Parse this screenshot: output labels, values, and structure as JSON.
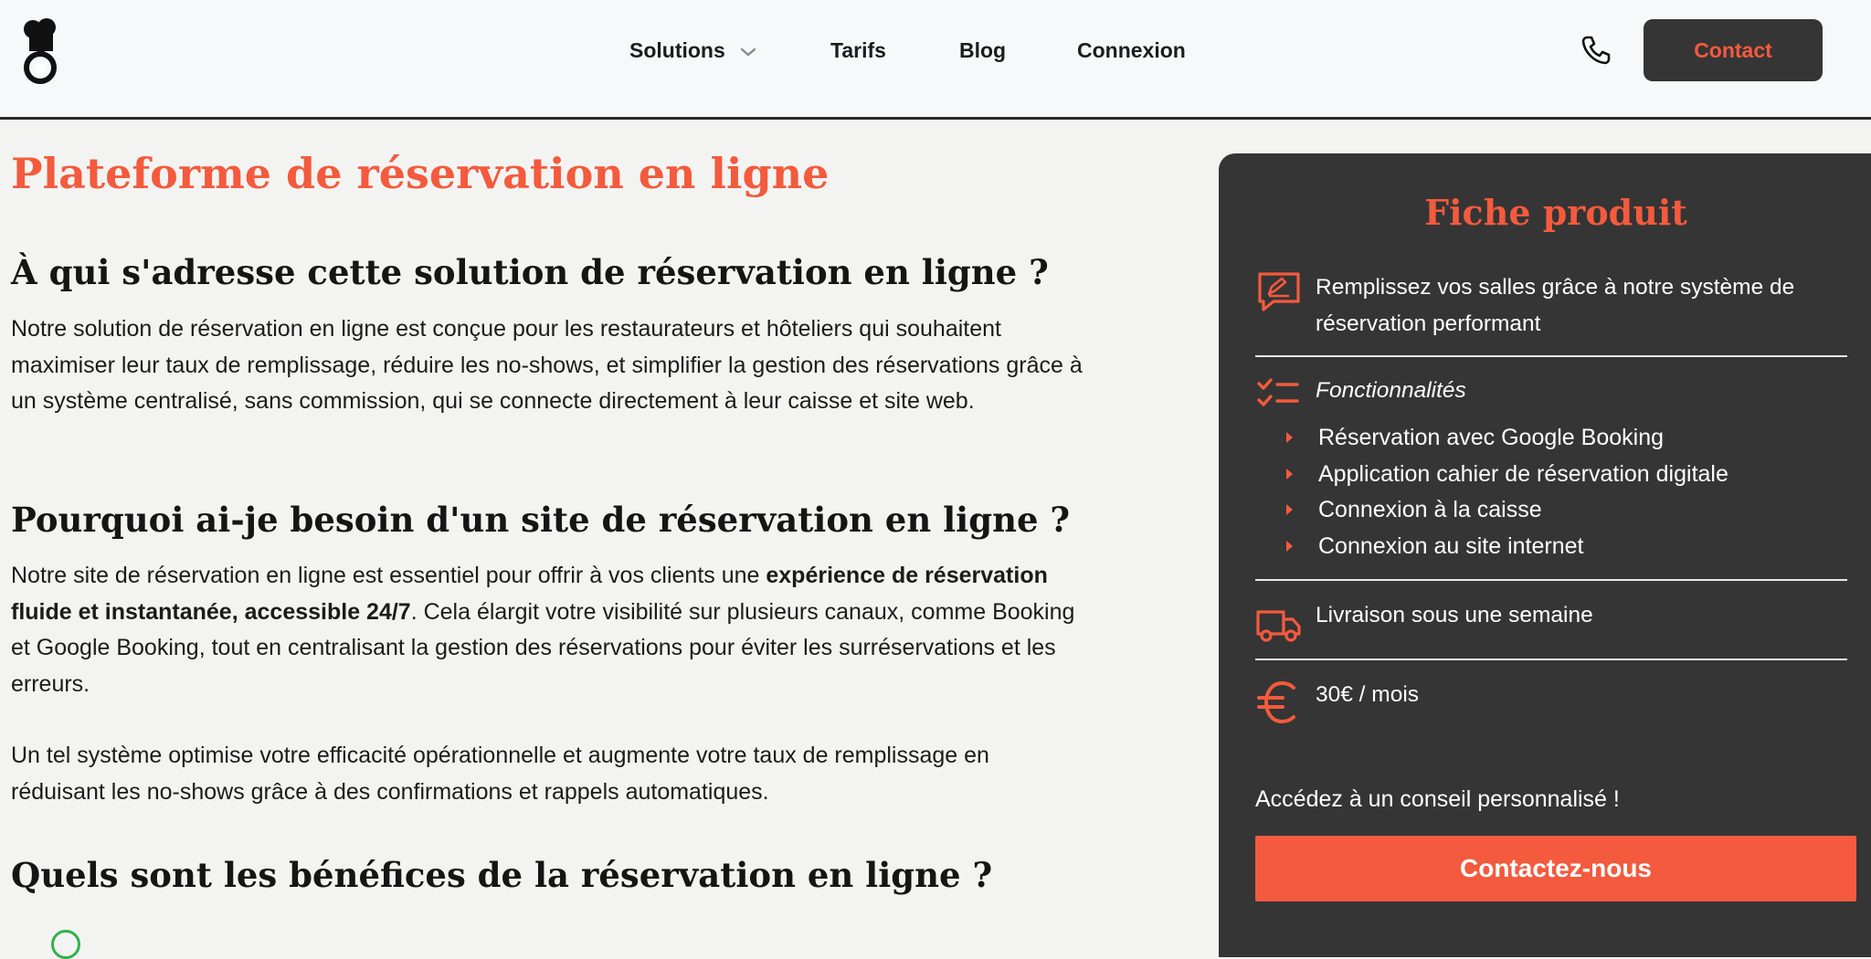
{
  "header": {
    "logo_icon": "chef-hat-logo-icon",
    "nav": {
      "solutions_label": "Solutions",
      "tarifs_label": "Tarifs",
      "blog_label": "Blog",
      "connexion_label": "Connexion"
    },
    "phone_icon": "phone-icon",
    "contact_label": "Contact"
  },
  "main": {
    "title": "Plateforme de réservation en ligne",
    "sections": [
      {
        "heading": "À qui s'adresse cette solution de réservation en ligne ?",
        "paragraph": "Notre solution de réservation en ligne est conçue pour les restaurateurs et hôteliers qui souhaitent maximiser leur taux de remplissage, réduire les no-shows, et simplifier la gestion des réservations grâce à un système centralisé, sans commission, qui se connecte directement à leur caisse et site web."
      },
      {
        "heading": "Pourquoi ai-je besoin d'un site de réservation en ligne ?",
        "paragraph_before_bold": "Notre site de réservation en ligne est essentiel pour offrir à vos clients une ",
        "paragraph_bold": "expérience de réservation fluide et instantanée, accessible 24/7",
        "paragraph_after_bold": ". Cela élargit votre visibilité sur plusieurs canaux, comme Booking et Google Booking, tout en centralisant la gestion des réservations pour éviter les surréservations et les erreurs.",
        "paragraph2": "Un tel système optimise votre efficacité opérationnelle et augmente votre taux de remplissage en réduisant les no-shows grâce à des confirmations et rappels automatiques."
      },
      {
        "heading": "Quels sont les bénéfices de la réservation en ligne ?"
      }
    ]
  },
  "card": {
    "title": "Fiche produit",
    "intro": "Remplissez vos salles grâce à notre système de réservation performant",
    "features_title": "Fonctionnalités",
    "features": [
      "Réservation avec Google Booking",
      "Application cahier de réservation digitale",
      "Connexion à la caisse",
      "Connexion au site internet"
    ],
    "delivery": "Livraison sous une semaine",
    "price": "30€ / mois",
    "cta_text": "Accédez à un conseil personnalisé !",
    "cta_button": "Contactez-nous",
    "accent_color": "#f45a3d",
    "card_bg": "#353535"
  }
}
